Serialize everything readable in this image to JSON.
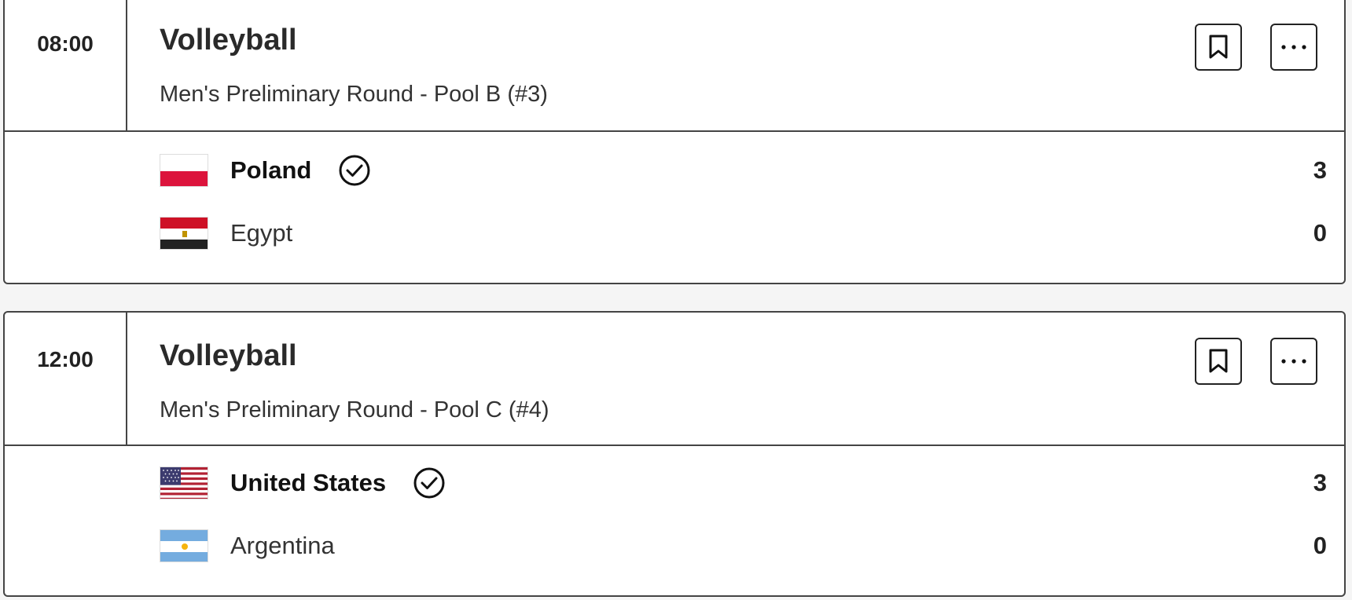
{
  "events": [
    {
      "time": "08:00",
      "sport": "Volleyball",
      "round": "Men's Preliminary Round - Pool B (#3)",
      "teams": [
        {
          "name": "Poland",
          "score": "3",
          "winner": true,
          "flag": "poland-flag"
        },
        {
          "name": "Egypt",
          "score": "0",
          "winner": false,
          "flag": "egypt-flag"
        }
      ]
    },
    {
      "time": "12:00",
      "sport": "Volleyball",
      "round": "Men's Preliminary Round - Pool C (#4)",
      "teams": [
        {
          "name": "United States",
          "score": "3",
          "winner": true,
          "flag": "usa-flag"
        },
        {
          "name": "Argentina",
          "score": "0",
          "winner": false,
          "flag": "argentina-flag"
        }
      ]
    }
  ],
  "icons": {
    "bookmark": "bookmark-icon",
    "more": "more-options-icon",
    "winner": "winner-check-icon"
  },
  "colors": {
    "border": "#444444",
    "background": "#f5f5f5",
    "card": "#ffffff"
  }
}
